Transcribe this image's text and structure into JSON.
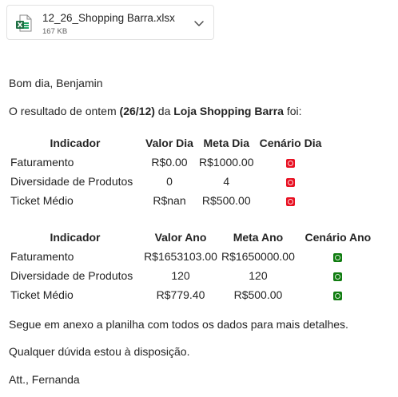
{
  "attachment": {
    "file_name": "12_26_Shopping Barra.xlsx",
    "file_size": "167 KB",
    "icon": "excel-file-icon"
  },
  "email": {
    "greeting": "Bom dia, Benjamin",
    "intro_prefix": "O resultado de ontem ",
    "intro_date": "(26/12)",
    "intro_mid": " da ",
    "intro_store": "Loja Shopping Barra",
    "intro_suffix": " foi:",
    "annex_note": "Segue em anexo a planilha com todos os dados para mais detalhes.",
    "doubts_note": "Qualquer dúvida estou à disposição.",
    "signoff": "Att., Fernanda"
  },
  "day_table": {
    "headers": [
      "Indicador",
      "Valor Dia",
      "Meta Dia",
      "Cenário Dia"
    ],
    "rows": [
      {
        "indicator": "Faturamento",
        "value": "R$0.00",
        "target": "R$1000.00",
        "status": "red"
      },
      {
        "indicator": "Diversidade de Produtos",
        "value": "0",
        "target": "4",
        "status": "red"
      },
      {
        "indicator": "Ticket Médio",
        "value": "R$nan",
        "target": "R$500.00",
        "status": "red"
      }
    ]
  },
  "year_table": {
    "headers": [
      "Indicador",
      "Valor Ano",
      "Meta Ano",
      "Cenário Ano"
    ],
    "rows": [
      {
        "indicator": "Faturamento",
        "value": "R$1653103.00",
        "target": "R$1650000.00",
        "status": "green"
      },
      {
        "indicator": "Diversidade de Produtos",
        "value": "120",
        "target": "120",
        "status": "green"
      },
      {
        "indicator": "Ticket Médio",
        "value": "R$779.40",
        "target": "R$500.00",
        "status": "green"
      }
    ]
  },
  "colors": {
    "status_red": "#e81123",
    "status_green": "#107c10",
    "excel_green": "#1d6f42"
  }
}
